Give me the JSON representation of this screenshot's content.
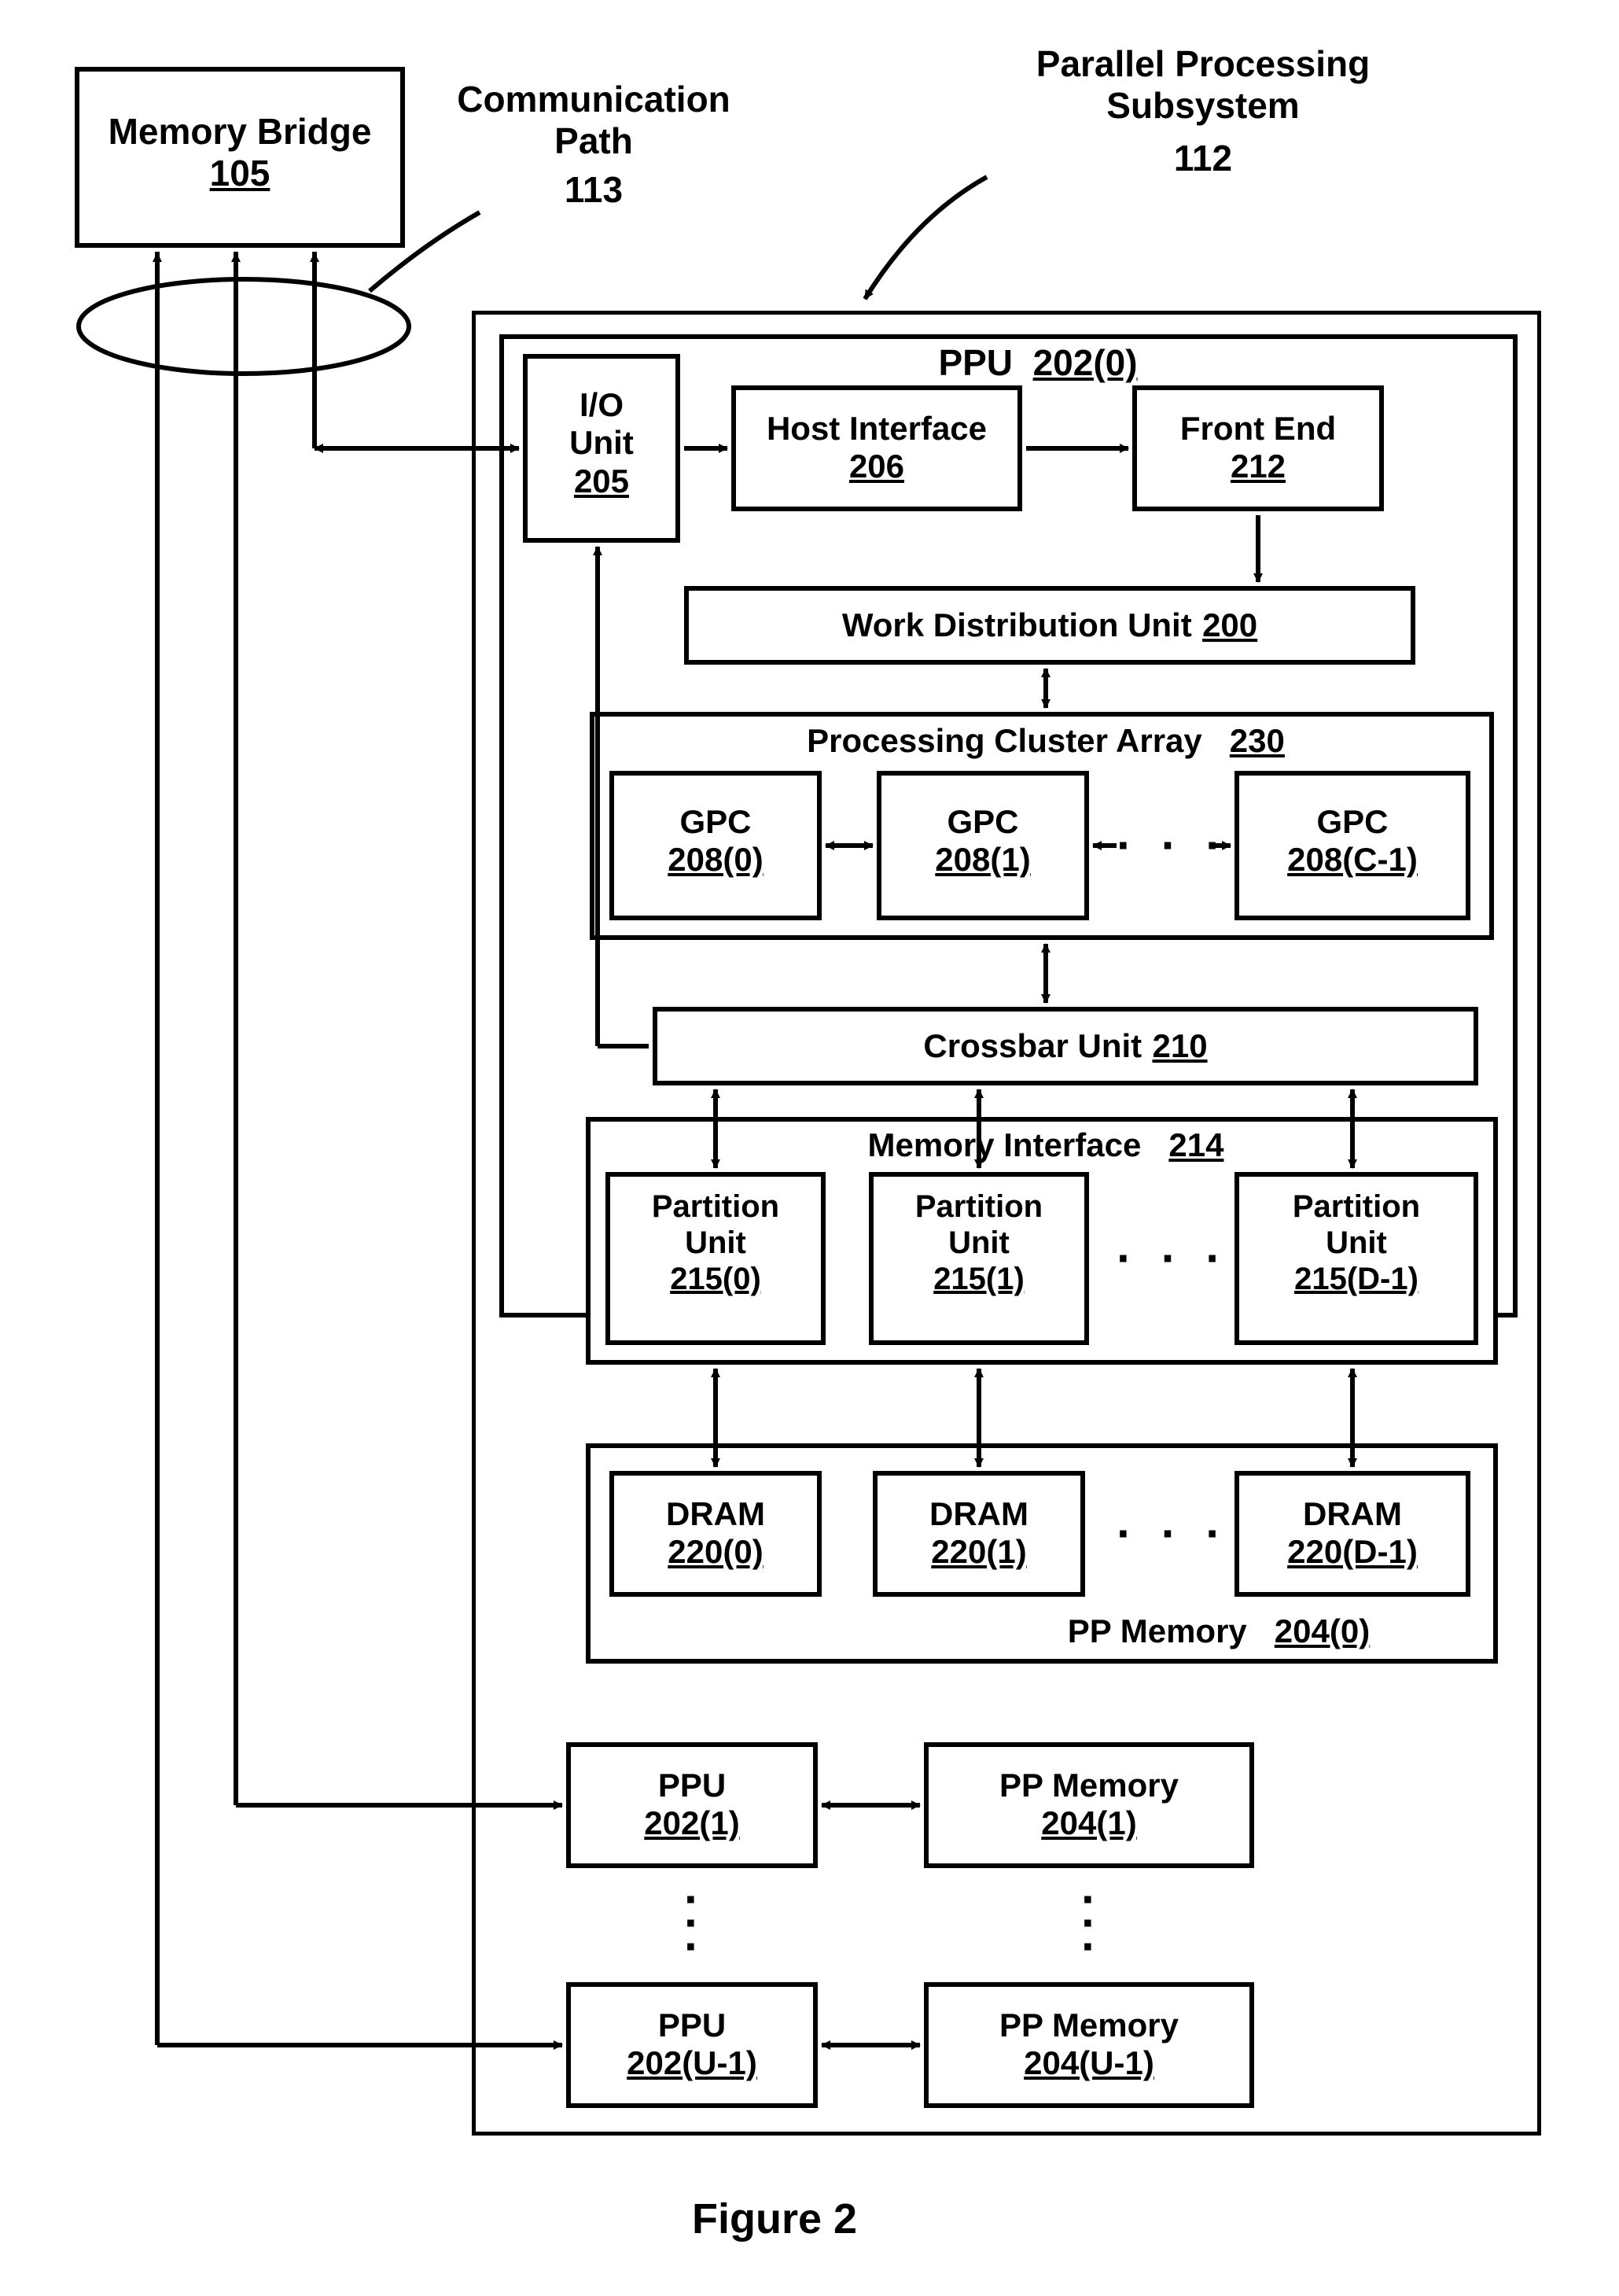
{
  "chart_data": {
    "type": "diagram",
    "title": "Figure 2",
    "nodes": [
      {
        "id": "memory_bridge",
        "label": "Memory Bridge",
        "num": "105"
      },
      {
        "id": "comm_path",
        "label": "Communication Path",
        "num": "113"
      },
      {
        "id": "pp_subsystem",
        "label": "Parallel Processing Subsystem",
        "num": "112"
      },
      {
        "id": "ppu0",
        "label": "PPU",
        "num": "202(0)"
      },
      {
        "id": "io_unit",
        "label": "I/O Unit",
        "num": "205"
      },
      {
        "id": "host_if",
        "label": "Host Interface",
        "num": "206"
      },
      {
        "id": "front_end",
        "label": "Front End",
        "num": "212"
      },
      {
        "id": "wdu",
        "label": "Work Distribution Unit",
        "num": "200"
      },
      {
        "id": "pca",
        "label": "Processing Cluster Array",
        "num": "230"
      },
      {
        "id": "gpc0",
        "label": "GPC",
        "num": "208(0)"
      },
      {
        "id": "gpc1",
        "label": "GPC",
        "num": "208(1)"
      },
      {
        "id": "gpcC",
        "label": "GPC",
        "num": "208(C-1)"
      },
      {
        "id": "crossbar",
        "label": "Crossbar Unit",
        "num": "210"
      },
      {
        "id": "mem_if",
        "label": "Memory Interface",
        "num": "214"
      },
      {
        "id": "part0",
        "label": "Partition Unit",
        "num": "215(0)"
      },
      {
        "id": "part1",
        "label": "Partition Unit",
        "num": "215(1)"
      },
      {
        "id": "partD",
        "label": "Partition Unit",
        "num": "215(D-1)"
      },
      {
        "id": "dram0",
        "label": "DRAM",
        "num": "220(0)"
      },
      {
        "id": "dram1",
        "label": "DRAM",
        "num": "220(1)"
      },
      {
        "id": "dramD",
        "label": "DRAM",
        "num": "220(D-1)"
      },
      {
        "id": "ppmem0",
        "label": "PP Memory",
        "num": "204(0)"
      },
      {
        "id": "ppu1",
        "label": "PPU",
        "num": "202(1)"
      },
      {
        "id": "ppmem1",
        "label": "PP Memory",
        "num": "204(1)"
      },
      {
        "id": "ppuU",
        "label": "PPU",
        "num": "202(U-1)"
      },
      {
        "id": "ppmemU",
        "label": "PP Memory",
        "num": "204(U-1)"
      }
    ],
    "edges": [
      {
        "from": "memory_bridge",
        "to": "io_unit",
        "dir": "both",
        "via": "comm_path"
      },
      {
        "from": "memory_bridge",
        "to": "ppu1",
        "dir": "both"
      },
      {
        "from": "memory_bridge",
        "to": "ppuU",
        "dir": "both"
      },
      {
        "from": "io_unit",
        "to": "host_if",
        "dir": "one"
      },
      {
        "from": "host_if",
        "to": "front_end",
        "dir": "one"
      },
      {
        "from": "front_end",
        "to": "wdu",
        "dir": "one"
      },
      {
        "from": "wdu",
        "to": "pca",
        "dir": "both"
      },
      {
        "from": "gpc0",
        "to": "gpc1",
        "dir": "both"
      },
      {
        "from": "gpc1",
        "to": "gpcC",
        "dir": "both"
      },
      {
        "from": "pca",
        "to": "crossbar",
        "dir": "both"
      },
      {
        "from": "crossbar",
        "to": "io_unit",
        "dir": "one"
      },
      {
        "from": "crossbar",
        "to": "part0",
        "dir": "both"
      },
      {
        "from": "crossbar",
        "to": "part1",
        "dir": "both"
      },
      {
        "from": "crossbar",
        "to": "partD",
        "dir": "both"
      },
      {
        "from": "part0",
        "to": "dram0",
        "dir": "both"
      },
      {
        "from": "part1",
        "to": "dram1",
        "dir": "both"
      },
      {
        "from": "partD",
        "to": "dramD",
        "dir": "both"
      },
      {
        "from": "ppu1",
        "to": "ppmem1",
        "dir": "both"
      },
      {
        "from": "ppuU",
        "to": "ppmemU",
        "dir": "both"
      }
    ]
  },
  "labels": {
    "memory_bridge": "Memory Bridge",
    "memory_bridge_num": "105",
    "comm_path": "Communication\nPath",
    "comm_path_num": "113",
    "pp_subsystem": "Parallel Processing\nSubsystem",
    "pp_subsystem_num": "112",
    "ppu": "PPU",
    "ppu0_num": "202(0)",
    "io_unit": "I/O\nUnit",
    "io_unit_num": "205",
    "host_if": "Host Interface",
    "host_if_num": "206",
    "front_end": "Front End",
    "front_end_num": "212",
    "wdu": "Work Distribution Unit",
    "wdu_num": "200",
    "pca": "Processing Cluster Array",
    "pca_num": "230",
    "gpc": "GPC",
    "gpc0_num": "208(0)",
    "gpc1_num": "208(1)",
    "gpcC_num": "208(C-1)",
    "crossbar": "Crossbar Unit",
    "crossbar_num": "210",
    "mem_if": "Memory Interface",
    "mem_if_num": "214",
    "part": "Partition\nUnit",
    "part0_num": "215(0)",
    "part1_num": "215(1)",
    "partD_num": "215(D-1)",
    "dram": "DRAM",
    "dram0_num": "220(0)",
    "dram1_num": "220(1)",
    "dramD_num": "220(D-1)",
    "ppmem": "PP Memory",
    "ppmem0_num": "204(0)",
    "ppu1_num": "202(1)",
    "ppmem1_num": "204(1)",
    "ppuU_num": "202(U-1)",
    "ppmemU_num": "204(U-1)",
    "figure": "Figure 2"
  }
}
